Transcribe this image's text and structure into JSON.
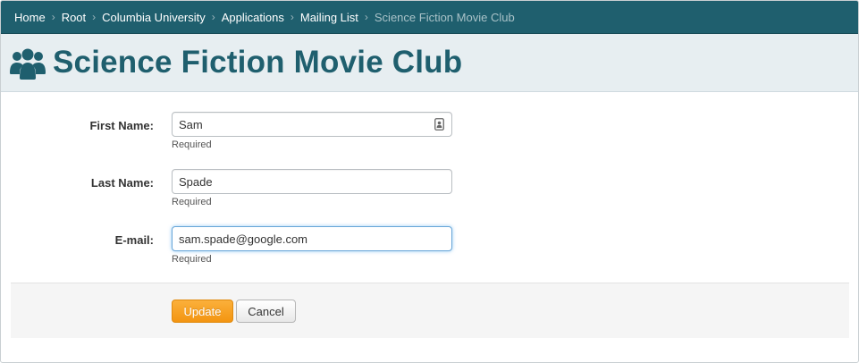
{
  "breadcrumb": {
    "items": [
      "Home",
      "Root",
      "Columbia University",
      "Applications",
      "Mailing List"
    ],
    "current": "Science Fiction Movie Club"
  },
  "header": {
    "title": "Science Fiction Movie Club",
    "icon": "users-icon"
  },
  "form": {
    "first_name": {
      "label": "First Name:",
      "value": "Sam",
      "hint": "Required"
    },
    "last_name": {
      "label": "Last Name:",
      "value": "Spade",
      "hint": "Required"
    },
    "email": {
      "label": "E-mail:",
      "value": "sam.spade@google.com",
      "hint": "Required"
    }
  },
  "actions": {
    "update_label": "Update",
    "cancel_label": "Cancel"
  },
  "colors": {
    "brand": "#1f5f6e",
    "primary_button": "#f39511",
    "focus_ring": "#69a6d8"
  }
}
